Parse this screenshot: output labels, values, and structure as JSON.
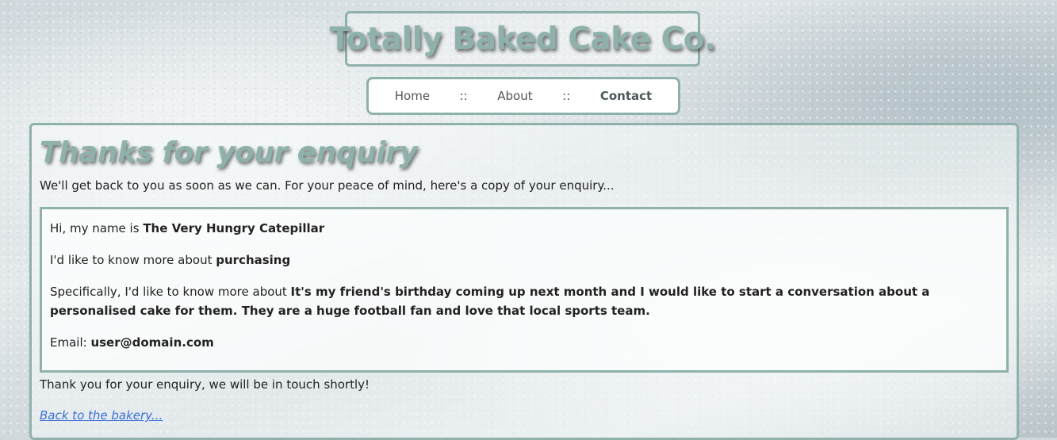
{
  "site": {
    "title": "Totally Baked Cake Co."
  },
  "nav": {
    "items": [
      {
        "label": "Home"
      },
      {
        "label": "About"
      },
      {
        "label": "Contact"
      }
    ],
    "separator": "::",
    "active": "Contact"
  },
  "page": {
    "heading": "Thanks for your enquiry",
    "intro": "We'll get back to you as soon as we can. For your peace of mind, here's a copy of your enquiry..."
  },
  "enquiry": {
    "name_prefix": "Hi, my name is ",
    "name": "The Very Hungry Catepillar",
    "topic_prefix": "I'd like to know more about ",
    "topic": "purchasing",
    "details_prefix": "Specifically, I'd like to know more about ",
    "details": "It's my friend's birthday coming up next month and I would like to start a conversation about a personalised cake for them. They are a huge football fan and love that local sports team.",
    "email_prefix": "Email: ",
    "email": "user@domain.com"
  },
  "footer": {
    "thanks": "Thank you for your enquiry, we will be in touch shortly!",
    "back_link": "Back to the bakery..."
  },
  "colors": {
    "accent": "#8fb1ac",
    "link": "#3a6fd8"
  }
}
